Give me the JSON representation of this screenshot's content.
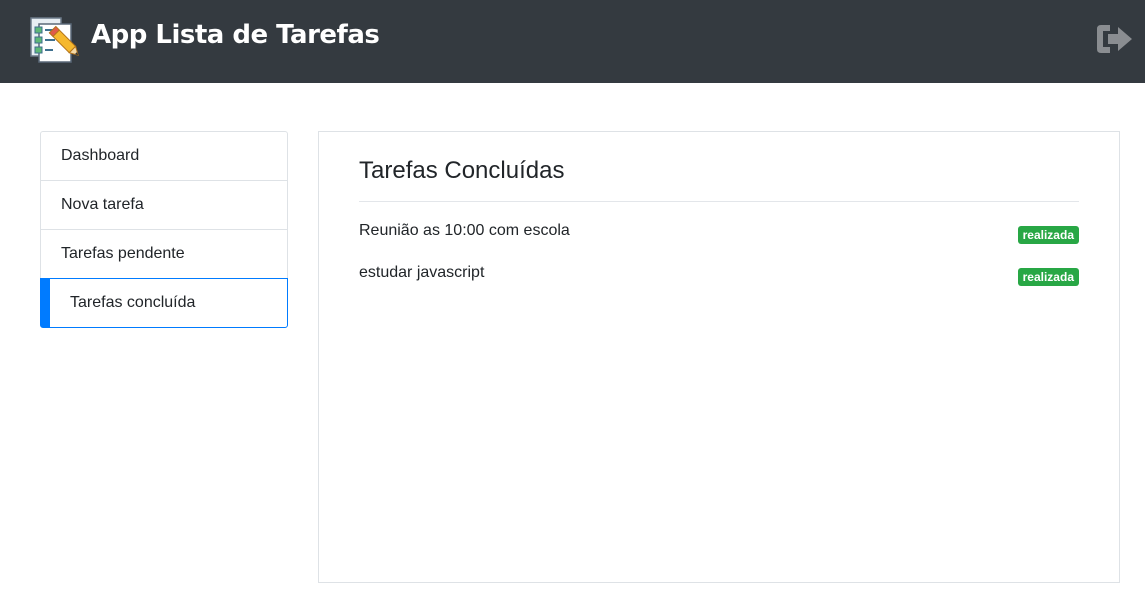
{
  "header": {
    "title": "App Lista de Tarefas",
    "logo_icon": "task-list-pencil-icon",
    "logout_icon": "sign-out-icon",
    "background": "#343a40"
  },
  "sidebar": {
    "items": [
      {
        "label": "Dashboard",
        "active": false
      },
      {
        "label": "Nova tarefa",
        "active": false
      },
      {
        "label": "Tarefas pendente",
        "active": false
      },
      {
        "label": "Tarefas concluída",
        "active": true
      }
    ],
    "active_color": "#007bff"
  },
  "main": {
    "title": "Tarefas Concluídas",
    "tasks": [
      {
        "text": "Reunião as 10:00 com escola",
        "status": "realizada"
      },
      {
        "text": "estudar javascript",
        "status": "realizada"
      }
    ],
    "badge_color": "#28a745"
  }
}
